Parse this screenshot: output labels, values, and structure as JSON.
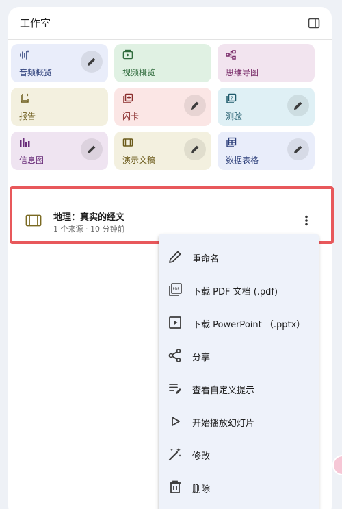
{
  "header": {
    "title": "工作室"
  },
  "tiles": [
    {
      "label": "音频概览",
      "icon": "audio-waveform-icon",
      "bg": "#e9edfa",
      "fg": "#2d3f7a",
      "editable": true
    },
    {
      "label": "视频概览",
      "icon": "video-icon",
      "bg": "#e0f1e3",
      "fg": "#2f6b3c",
      "editable": false
    },
    {
      "label": "思维导图",
      "icon": "mind-map-icon",
      "bg": "#f2e4ef",
      "fg": "#7a2d6a",
      "editable": false
    },
    {
      "label": "报告",
      "icon": "report-icon",
      "bg": "#f3f0df",
      "fg": "#6b5a1a",
      "editable": false
    },
    {
      "label": "闪卡",
      "icon": "flashcards-icon",
      "bg": "#fbe6e5",
      "fg": "#8a2d2d",
      "editable": true
    },
    {
      "label": "测验",
      "icon": "quiz-icon",
      "bg": "#dff0f5",
      "fg": "#1f5a6b",
      "editable": true
    },
    {
      "label": "信息图",
      "icon": "infographic-icon",
      "bg": "#efe4f1",
      "fg": "#6a2d7a",
      "editable": true
    },
    {
      "label": "演示文稿",
      "icon": "slides-icon",
      "bg": "#f3f0df",
      "fg": "#6b5a1a",
      "editable": true
    },
    {
      "label": "数据表格",
      "icon": "data-table-icon",
      "bg": "#e9edfa",
      "fg": "#2d3f7a",
      "editable": true
    }
  ],
  "item": {
    "title": "地理：真实的经文",
    "meta": "1 个来源 · 10 分钟前",
    "icon": "slides-icon"
  },
  "menu": {
    "items": [
      {
        "label": "重命名",
        "icon": "pencil-icon"
      },
      {
        "label": "下载 PDF 文档 (.pdf)",
        "icon": "pdf-icon"
      },
      {
        "label": "下载 PowerPoint （.pptx）",
        "icon": "play-box-icon"
      },
      {
        "label": "分享",
        "icon": "share-icon"
      },
      {
        "label": "查看自定义提示",
        "icon": "edit-note-icon"
      },
      {
        "label": "开始播放幻灯片",
        "icon": "play-icon"
      },
      {
        "label": "修改",
        "icon": "magic-wand-icon"
      },
      {
        "label": "删除",
        "icon": "trash-icon"
      }
    ]
  }
}
